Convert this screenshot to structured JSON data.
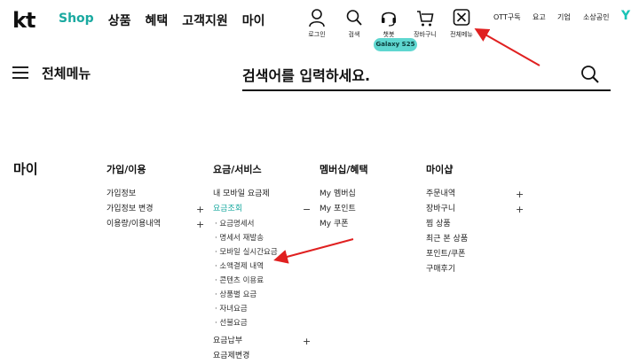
{
  "header": {
    "logo": "kt",
    "nav": [
      {
        "label": "Shop"
      },
      {
        "label": "상품"
      },
      {
        "label": "혜택"
      },
      {
        "label": "고객지원"
      },
      {
        "label": "마이"
      }
    ],
    "icons": [
      {
        "label": "로그인",
        "icon": "person-icon"
      },
      {
        "label": "검색",
        "icon": "search-icon"
      },
      {
        "label": "챗봇",
        "icon": "headset-icon"
      },
      {
        "label": "장바구니",
        "icon": "cart-icon"
      },
      {
        "label": "전체메뉴",
        "icon": "close-box-icon"
      }
    ],
    "badge": "Galaxy S25",
    "right_links": [
      "OTT구독",
      "요고",
      "기업",
      "소상공인"
    ],
    "right_logo": "Y"
  },
  "search": {
    "menu_title": "전체메뉴",
    "placeholder": "검색어를 입력하세요."
  },
  "menu": {
    "section_title": "마이",
    "columns": [
      {
        "title": "가입/이용",
        "items": [
          {
            "label": "가입정보",
            "sign": ""
          },
          {
            "label": "가입정보 변경",
            "sign": "+"
          },
          {
            "label": "이용량/이용내역",
            "sign": "+"
          }
        ]
      },
      {
        "title": "요금/서비스",
        "items": [
          {
            "label": "내 모바일 요금제",
            "sign": ""
          },
          {
            "label": "요금조회",
            "sign": "−",
            "active": true,
            "subitems": [
              "· 요금명세서",
              "· 명세서 재발송",
              "· 모바일 실시간요금",
              "· 소액결제 내역",
              "· 콘텐츠 이용료",
              "· 상품별 요금",
              "· 자녀요금",
              "· 선불요금"
            ]
          },
          {
            "label": "요금납부",
            "sign": "+"
          },
          {
            "label": "요금제변경",
            "sign": ""
          }
        ]
      },
      {
        "title": "멤버십/혜택",
        "items": [
          {
            "label": "My 멤버십",
            "sign": ""
          },
          {
            "label": "My 포인트",
            "sign": ""
          },
          {
            "label": "My 쿠폰",
            "sign": ""
          }
        ]
      },
      {
        "title": "마이샵",
        "items": [
          {
            "label": "주문내역",
            "sign": "+"
          },
          {
            "label": "장바구니",
            "sign": "+"
          },
          {
            "label": "찜 상품",
            "sign": ""
          },
          {
            "label": "최근 본 상품",
            "sign": ""
          },
          {
            "label": "포인트/쿠폰",
            "sign": ""
          },
          {
            "label": "구매후기",
            "sign": ""
          }
        ]
      }
    ]
  },
  "colors": {
    "accent": "#1aa9a0",
    "badge_bg": "#5fd7d0",
    "annotation_arrow": "#e02020"
  }
}
